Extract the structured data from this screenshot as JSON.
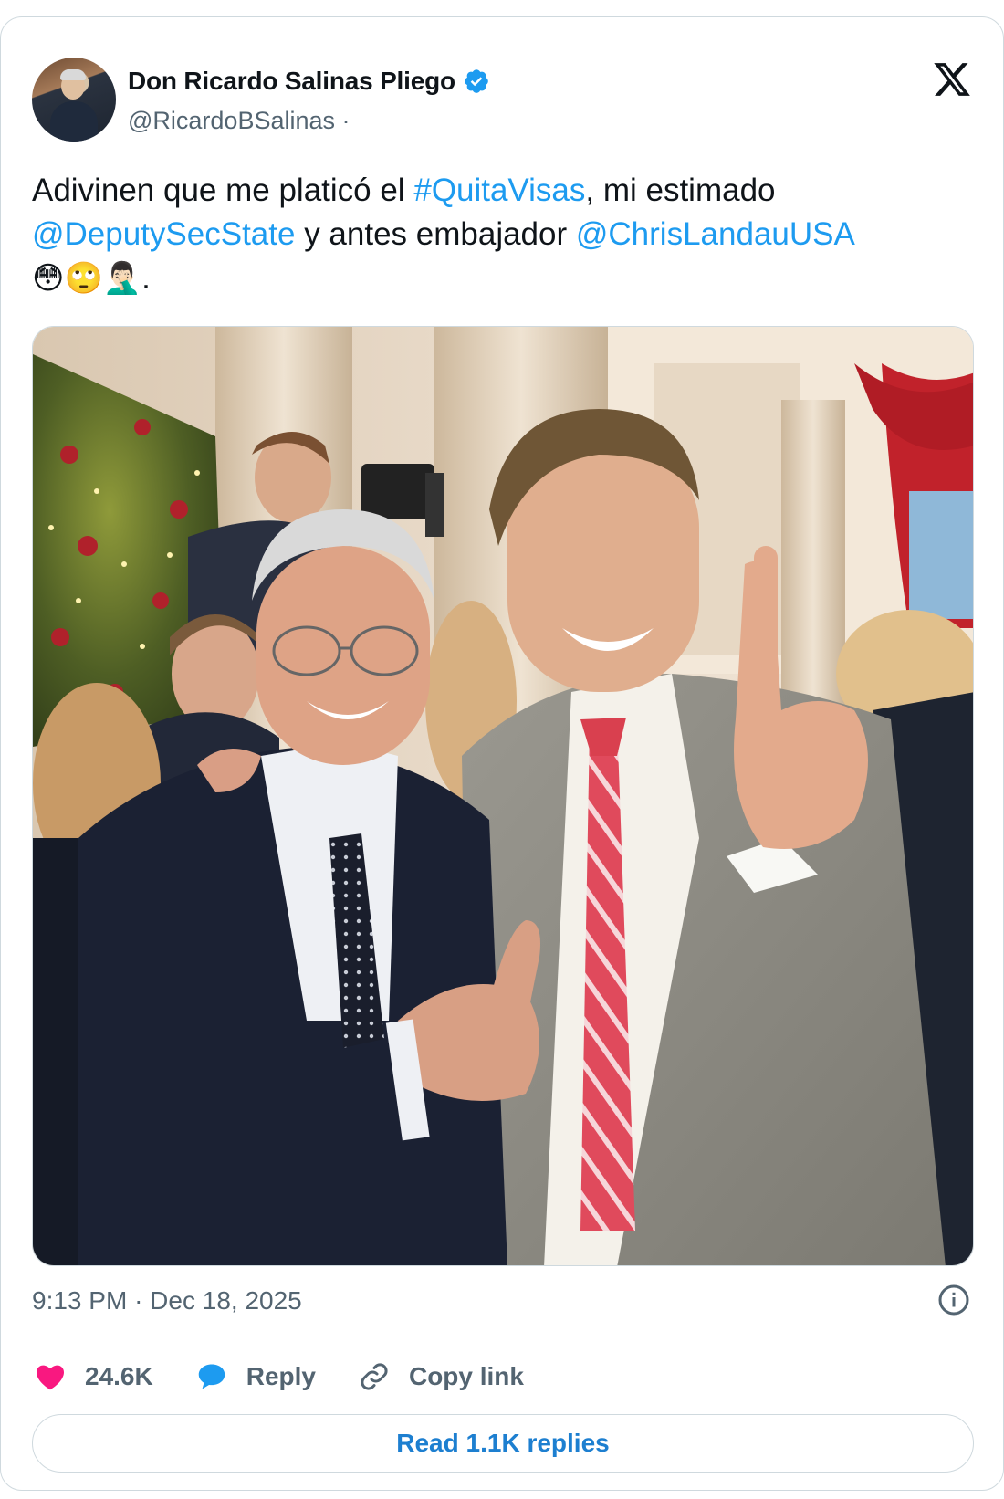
{
  "author": {
    "display_name": "Don Ricardo Salinas Pliego",
    "handle": "@RicardoBSalinas",
    "separator": "·",
    "verified_icon": "verified-badge-icon",
    "verified_color": "#1d9bf0"
  },
  "platform_icon": "x-logo-icon",
  "tweet": {
    "text_1": "Adivinen que me platicó el ",
    "hashtag": "#QuitaVisas",
    "text_2": ", mi estimado ",
    "mention_1": "@DeputySecState",
    "text_3": " y antes embajador ",
    "mention_2": "@ChrisLandauUSA",
    "emojis": "😳🙄🤦🏻‍♂️",
    "text_end": "."
  },
  "photo": {
    "icon": "photo-image"
  },
  "meta": {
    "time": "9:13 PM",
    "separator": "·",
    "date": "Dec 18, 2025",
    "info_icon": "info-icon"
  },
  "actions": {
    "like_count": "24.6K",
    "reply_label": "Reply",
    "copy_label": "Copy link"
  },
  "read_replies_label": "Read 1.1K replies",
  "colors": {
    "link": "#1d9bf0",
    "heart": "#f91880",
    "secondary_text": "#536471",
    "border": "#cfd9de"
  }
}
